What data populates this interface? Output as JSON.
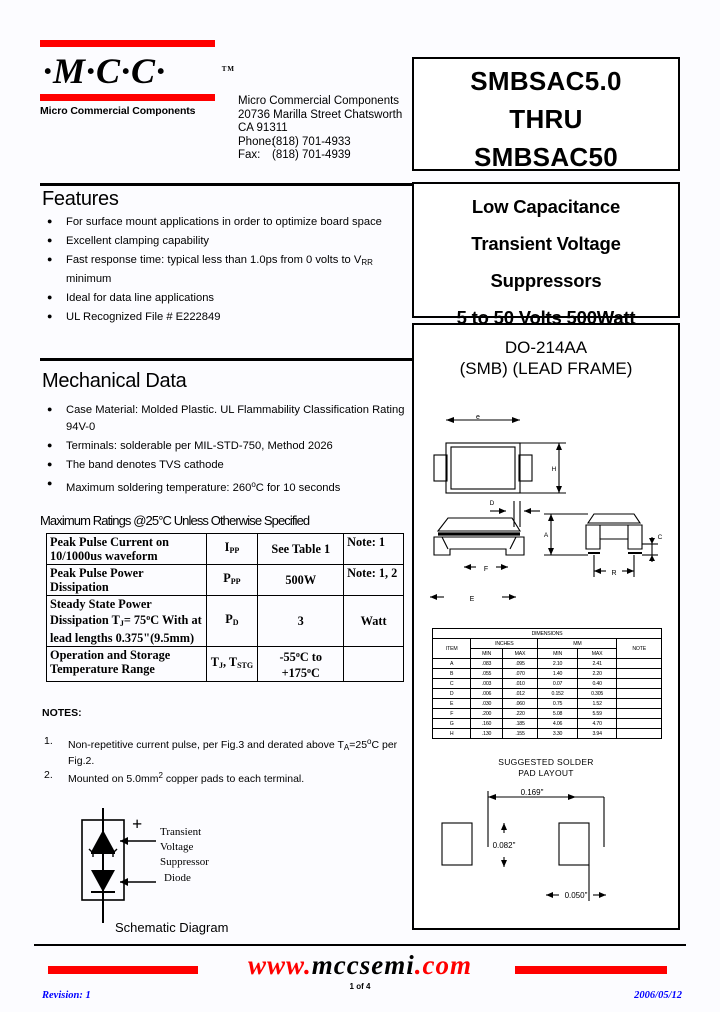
{
  "company": {
    "logo_text": "·M·C·C·",
    "logo_tm": "TM",
    "logo_subtitle": "Micro Commercial Components",
    "address": {
      "name": "Micro Commercial Components",
      "street": "20736 Marilla Street Chatsworth",
      "city_state_zip": "CA 91311",
      "phone_label": "Phone:",
      "phone": "(818) 701-4933",
      "fax_label": "Fax:",
      "fax": "(818) 701-4939"
    }
  },
  "part_box": {
    "line1": "SMBSAC5.0",
    "line2": "THRU",
    "line3": "SMBSAC50"
  },
  "application_box": {
    "line1": "Low Capacitance",
    "line2": "Transient Voltage",
    "line3": "Suppressors",
    "line4": "5 to 50 Volts  500Watt"
  },
  "features": {
    "title": "Features",
    "items": [
      "For surface mount applications  in order to optimize board space",
      "Excellent clamping capability",
      "Fast response time: typical less than 1.0ps from 0 volts to V<sub>RR</sub> minimum",
      "Ideal for data line applications",
      "UL Recognized File # E222849"
    ]
  },
  "mechanical": {
    "title": "Mechanical Data",
    "items": [
      "Case Material: Molded Plastic.  UL Flammability Classification Rating 94V-0",
      "Terminals:   solderable per MIL-STD-750,  Method  2026",
      "The band denotes TVS cathode",
      "Maximum soldering temperature: 260<sup>o</sup>C for 10 seconds"
    ]
  },
  "max_ratings_caption": "Maximum Ratings @25°C Unless Otherwise Specified",
  "ratings_table": {
    "rows": [
      {
        "parameter": "Peak Pulse Current on 10/1000us waveform",
        "symbol": "I<sub>PP</sub>",
        "value": "See Table 1",
        "unit": "Note: 1"
      },
      {
        "parameter": "Peak Pulse Power Dissipation",
        "symbol": "P<sub>PP</sub>",
        "value": "500W",
        "unit": "Note: 1, 2"
      },
      {
        "parameter": "Steady State Power Dissipation T<sub>J</sub>= 75<sup>o</sup>C With at lead lengths  0.375\"(9.5mm)",
        "symbol": "P<sub>D</sub>",
        "value": "3",
        "unit": "Watt"
      },
      {
        "parameter": "Operation and Storage Temperature Range",
        "symbol": "T<sub>J</sub>, T<sub>STG</sub>",
        "value": "-55<sup>o</sup>C to +175<sup>o</sup>C",
        "unit": ""
      }
    ]
  },
  "notes": {
    "heading": "NOTES:",
    "items": [
      {
        "num": "1.",
        "text": "Non-repetitive current pulse,  per Fig.3 and derated above T<sub>A</sub>=25<sup>o</sup>C per Fig.2."
      },
      {
        "num": "2.",
        "text": "Mounted on 5.0mm<sup>2</sup> copper pads to each terminal."
      }
    ]
  },
  "schematic": {
    "caption": "Schematic Diagram",
    "plus": "+",
    "label_lines": [
      "Transient",
      "Voltage",
      "Suppressor",
      "Diode"
    ]
  },
  "package": {
    "title_line1": "DO-214AA",
    "title_line2": "(SMB) (LEAD FRAME)",
    "dim_labels": {
      "e": "e",
      "H": "H",
      "D": "D",
      "F": "F",
      "A": "A",
      "R": "R",
      "C": "C",
      "E": "E"
    },
    "dimensions_table": {
      "title": "DIMENSIONS",
      "group_headers": [
        "INCHES",
        "MM"
      ],
      "column_headers": [
        "ITEM",
        "MIN",
        "MAX",
        "MIN",
        "MAX",
        "NOTE"
      ],
      "rows": [
        {
          "item": "A",
          "in_min": ".083",
          "in_max": ".095",
          "mm_min": "2.10",
          "mm_max": "2.41",
          "note": ""
        },
        {
          "item": "B",
          "in_min": ".055",
          "in_max": ".070",
          "mm_min": "1.40",
          "mm_max": "2.20",
          "note": ""
        },
        {
          "item": "C",
          "in_min": ".003",
          "in_max": ".010",
          "mm_min": "0.07",
          "mm_max": "0.40",
          "note": ""
        },
        {
          "item": "D",
          "in_min": ".006",
          "in_max": ".012",
          "mm_min": "0.152",
          "mm_max": "0.305",
          "note": ""
        },
        {
          "item": "E",
          "in_min": ".030",
          "in_max": ".060",
          "mm_min": "0.75",
          "mm_max": "1.52",
          "note": ""
        },
        {
          "item": "F",
          "in_min": ".200",
          "in_max": ".220",
          "mm_min": "5.08",
          "mm_max": "5.59",
          "note": ""
        },
        {
          "item": "G",
          "in_min": ".160",
          "in_max": ".185",
          "mm_min": "4.06",
          "mm_max": "4.70",
          "note": ""
        },
        {
          "item": "H",
          "in_min": ".130",
          "in_max": ".155",
          "mm_min": "3.30",
          "mm_max": "3.94",
          "note": ""
        }
      ]
    },
    "pad_layout": {
      "title_line1": "SUGGESTED SOLDER",
      "title_line2": "PAD LAYOUT",
      "dim_width": "0.169\"",
      "dim_height": "0.082\"",
      "dim_pad": "0.050\""
    }
  },
  "footer": {
    "url_red_1": "www.",
    "url_black": "mccsemi",
    "url_red_2": ".com",
    "revision": "Revision: 1",
    "page": "1 of 4",
    "date": "2006/05/12"
  },
  "colors": {
    "brand_red": "#ff0000",
    "footer_blue": "#0000ff"
  }
}
